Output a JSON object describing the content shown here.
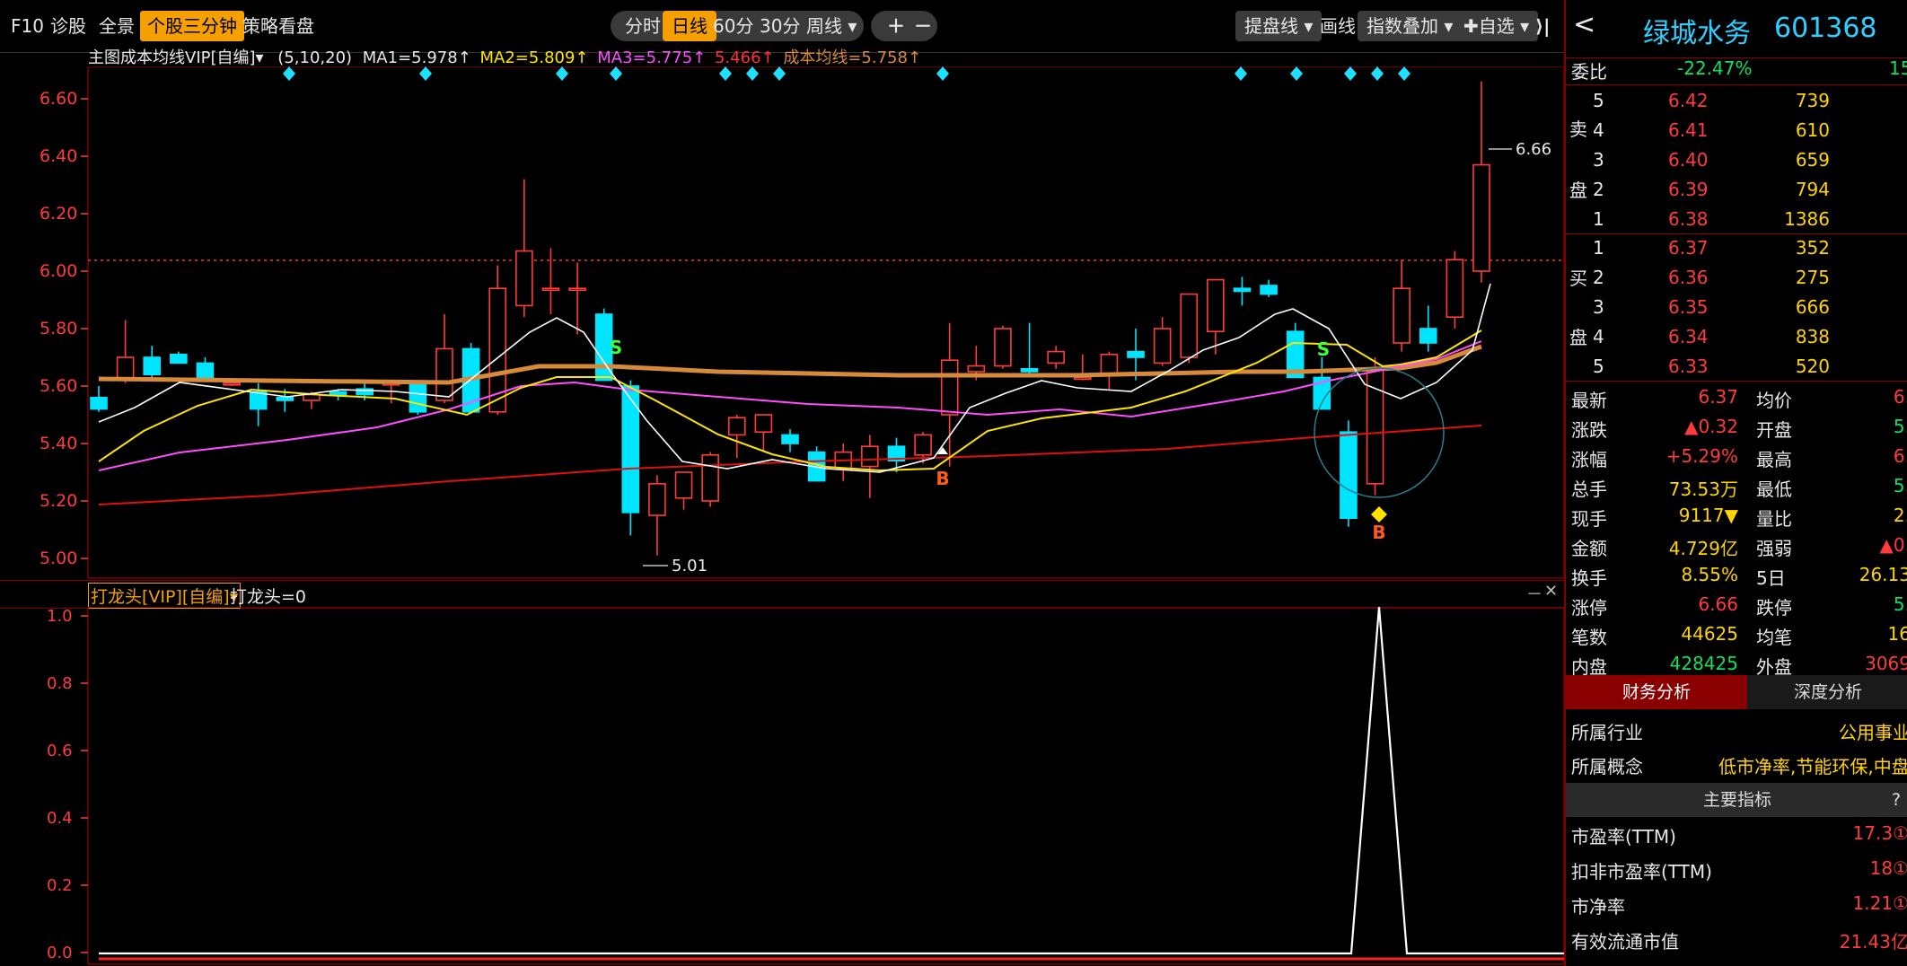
{
  "toolbar": {
    "left_items": [
      "F10",
      "诊股",
      "全景",
      "个股三分钟",
      "策略看盘"
    ],
    "period_tabs": [
      "分时",
      "日线",
      "60分",
      "30分",
      "周线 ▾"
    ],
    "zoom": [
      "＋",
      "－"
    ],
    "right_items": [
      "提盘线 ▾",
      "画线",
      "指数叠加 ▾",
      "✚自选 ▾"
    ],
    "collapse": "⟩|"
  },
  "main_chart": {
    "indicator_title": "主图成本均线VIP[自编]▾",
    "params": "(5,10,20)",
    "ma1": "MA1=5.978↑",
    "ma2": "MA2=5.809↑",
    "ma3": "MA3=5.775↑",
    "extra": "5.466↑",
    "cost_ma": "成本均线=5.758↑",
    "price_labels": [
      "6.60",
      "6.40",
      "6.20",
      "6.00",
      "5.80",
      "5.60",
      "5.40",
      "5.20",
      "5.00"
    ],
    "high_label": "6.66",
    "low_label": "5.01",
    "signal_s": "S",
    "signal_b": "B",
    "colors": {
      "up": "#ff3b3b",
      "down": "#00e5ff",
      "ma1": "#ffffff",
      "ma2": "#ffe500",
      "ma3": "#ff4dff",
      "cost": "#d68a3a",
      "long": "#e01010"
    }
  },
  "sub_chart": {
    "indicator_title": "打龙头[VIP][自编]▾",
    "value": "打龙头=0",
    "y_labels": [
      "1.0",
      "0.8",
      "0.6",
      "0.4",
      "0.2",
      "0.0"
    ],
    "controls": [
      "－",
      "✕"
    ]
  },
  "stock": {
    "name": "绿城水务",
    "code": "601368",
    "nav_back": "<"
  },
  "order_book": {
    "webi_label": "委比",
    "webi_value": "-22.47%",
    "webi_extra": "15",
    "sell_side_chars": [
      "卖",
      "盘"
    ],
    "buy_side_chars": [
      "买",
      "盘"
    ],
    "sells": [
      {
        "n": "5",
        "price": "6.42",
        "vol": "739"
      },
      {
        "n": "4",
        "price": "6.41",
        "vol": "610"
      },
      {
        "n": "3",
        "price": "6.40",
        "vol": "659"
      },
      {
        "n": "2",
        "price": "6.39",
        "vol": "794"
      },
      {
        "n": "1",
        "price": "6.38",
        "vol": "1386"
      }
    ],
    "buys": [
      {
        "n": "1",
        "price": "6.37",
        "vol": "352"
      },
      {
        "n": "2",
        "price": "6.36",
        "vol": "275"
      },
      {
        "n": "3",
        "price": "6.35",
        "vol": "666"
      },
      {
        "n": "4",
        "price": "6.34",
        "vol": "838"
      },
      {
        "n": "5",
        "price": "6.33",
        "vol": "520"
      }
    ]
  },
  "quote": [
    {
      "l1": "最新",
      "v1": "6.37",
      "c1": "red",
      "l2": "均价",
      "v2": "6.",
      "c2": "red"
    },
    {
      "l1": "涨跌",
      "v1": "▲0.32",
      "c1": "red",
      "l2": "开盘",
      "v2": "5.",
      "c2": "green"
    },
    {
      "l1": "涨幅",
      "v1": "+5.29%",
      "c1": "red",
      "l2": "最高",
      "v2": "6.",
      "c2": "red"
    },
    {
      "l1": "总手",
      "v1": "73.53万",
      "c1": "yellow",
      "l2": "最低",
      "v2": "5.",
      "c2": "green"
    },
    {
      "l1": "现手",
      "v1": "9117▼",
      "c1": "yellow",
      "l2": "量比",
      "v2": "2.",
      "c2": "yellow"
    },
    {
      "l1": "金额",
      "v1": "4.729亿",
      "c1": "yellow",
      "l2": "强弱",
      "v2": "▲0.",
      "c2": "red"
    },
    {
      "l1": "换手",
      "v1": "8.55%",
      "c1": "yellow",
      "l2": "5日",
      "v2": "26.13",
      "c2": "yellow"
    },
    {
      "l1": "涨停",
      "v1": "6.66",
      "c1": "red",
      "l2": "跌停",
      "v2": "5.",
      "c2": "green"
    },
    {
      "l1": "笔数",
      "v1": "44625",
      "c1": "yellow",
      "l2": "均笔",
      "v2": "16",
      "c2": "yellow"
    },
    {
      "l1": "内盘",
      "v1": "428425",
      "c1": "green",
      "l2": "外盘",
      "v2": "3069",
      "c2": "red"
    }
  ],
  "tabs": {
    "fin": "财务分析",
    "depth": "深度分析",
    "main_idx": "主要指标",
    "q": "?"
  },
  "info": {
    "industry_label": "所属行业",
    "industry_value": "公用事业",
    "concept_label": "所属概念",
    "concept_value": "低市净率,节能环保,中盘"
  },
  "metrics": [
    {
      "label": "市盈率(TTM)",
      "value": "17.3①"
    },
    {
      "label": "扣非市盈率(TTM)",
      "value": "18①"
    },
    {
      "label": "市净率",
      "value": "1.21①"
    },
    {
      "label": "有效流通市值",
      "value": "21.43亿"
    }
  ]
}
